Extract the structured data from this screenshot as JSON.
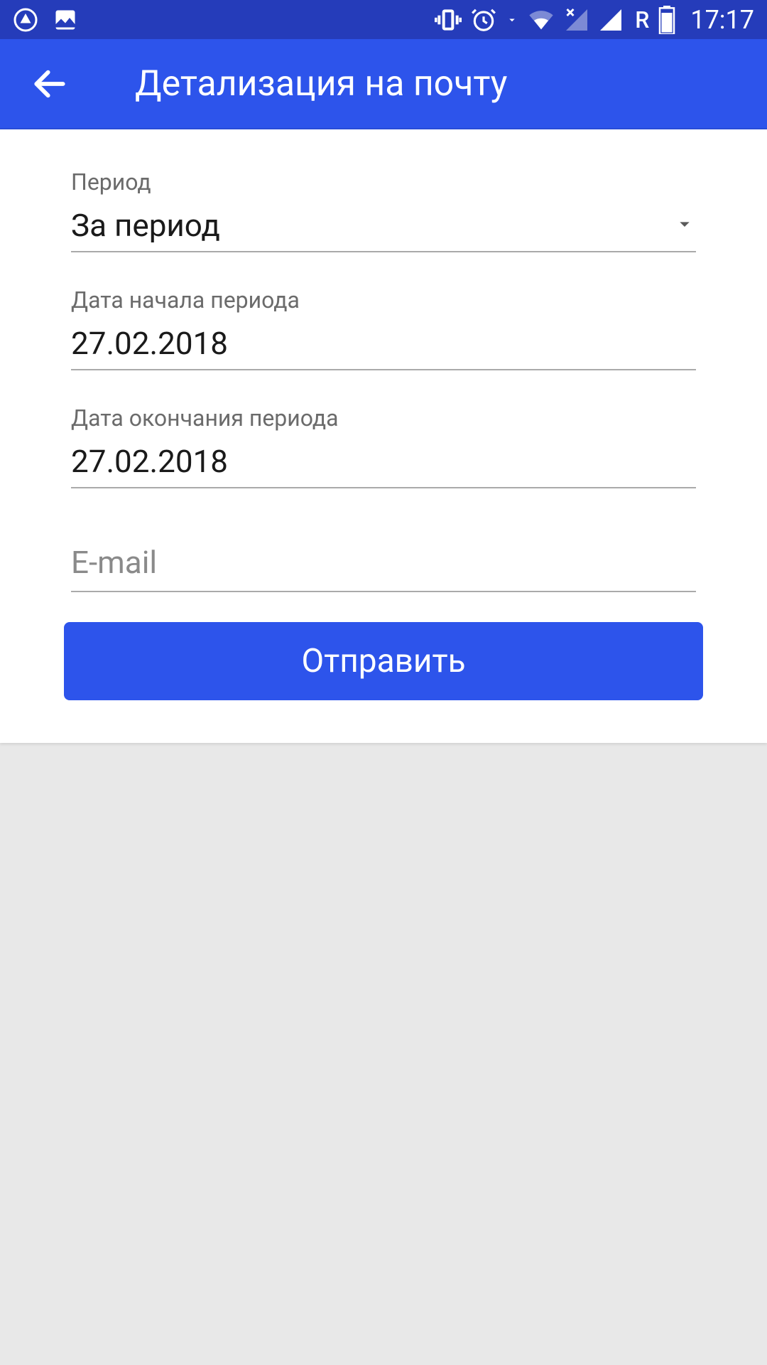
{
  "statusBar": {
    "time": "17:17",
    "roaming": "R"
  },
  "header": {
    "title": "Детализация на почту"
  },
  "form": {
    "period": {
      "label": "Период",
      "value": "За период"
    },
    "startDate": {
      "label": "Дата начала периода",
      "value": "27.02.2018"
    },
    "endDate": {
      "label": "Дата окончания периода",
      "value": "27.02.2018"
    },
    "email": {
      "placeholder": "E-mail"
    },
    "submitLabel": "Отправить"
  }
}
